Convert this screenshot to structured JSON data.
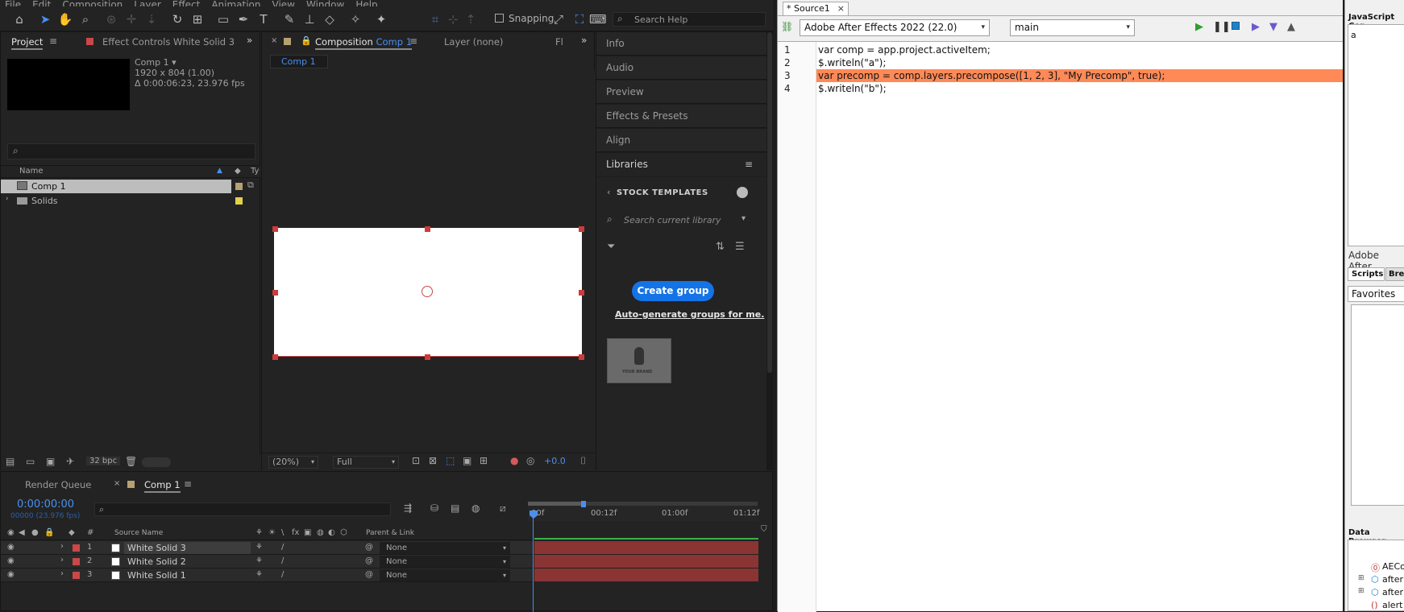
{
  "menu": [
    "File",
    "Edit",
    "Composition",
    "Layer",
    "Effect",
    "Animation",
    "View",
    "Window",
    "Help"
  ],
  "toolbar": {
    "snapping_label": "Snapping",
    "search_placeholder": "Search Help"
  },
  "project_panel": {
    "tab_project": "Project",
    "tab_effect_controls": "Effect Controls White Solid 3",
    "comp_name": "Comp 1 ▾",
    "comp_dims": "1920 x 804 (1.00)",
    "comp_duration": "Δ 0:00:06:23, 23.976 fps",
    "search_placeholder": "",
    "col_name": "Name",
    "col_type": "Ty",
    "items": [
      {
        "name": "Comp 1",
        "label_color": "#b7a071"
      },
      {
        "name": "Solids",
        "label_color": "#e3d04a"
      }
    ],
    "bpc": "32 bpc"
  },
  "composition_panel": {
    "tab_comp": "Composition",
    "tab_comp_name": "Comp 1",
    "tab_layer": "Layer (none)",
    "tab_more": "Fl",
    "breadcrumb": "Comp 1",
    "zoom": "(20%)",
    "resolution": "Full",
    "exposure": "+0.0"
  },
  "right_panels": {
    "items": [
      "Info",
      "Audio",
      "Preview",
      "Effects & Presets",
      "Align",
      "Libraries"
    ],
    "stock_templates": "STOCK TEMPLATES",
    "search_placeholder": "Search current library",
    "create_group": "Create group",
    "auto_generate": "Auto-generate groups for me.",
    "thumb_label": "YOUR BRAND"
  },
  "timeline": {
    "tab_render_queue": "Render Queue",
    "tab_comp": "Comp 1",
    "timecode": "0:00:00:00",
    "frames": "00000 (23.976 fps)",
    "col_source_name": "Source Name",
    "col_parent": "Parent & Link",
    "ruler": [
      "00f",
      "00:12f",
      "01:00f",
      "01:12f"
    ],
    "layers": [
      {
        "num": "1",
        "name": "White Solid 3",
        "parent": "None"
      },
      {
        "num": "2",
        "name": "White Solid 2",
        "parent": "None"
      },
      {
        "num": "3",
        "name": "White Solid 1",
        "parent": "None"
      }
    ]
  },
  "extendscript": {
    "tab": "* Source1",
    "target": "Adobe After Effects 2022 (22.0)",
    "engine": "main",
    "lines": [
      {
        "n": "1",
        "text": "var comp = app.project.activeItem;"
      },
      {
        "n": "2",
        "text": "$.writeln(\"a\");"
      },
      {
        "n": "3",
        "text": "var precomp = comp.layers.precompose([1, 2, 3], \"My Precomp\", true);"
      },
      {
        "n": "4",
        "text": "$.writeln(\"b\");"
      }
    ],
    "highlight_color": "#ff8a57"
  },
  "right_column": {
    "console_title": "JavaScript Cor",
    "console_output": "a",
    "after_label": "Adobe After",
    "tab_scripts": "Scripts",
    "tab_breakpoints": "Brea",
    "favorites": "Favorites",
    "data_browser": "Data Browser",
    "tree": [
      "AECo",
      "after",
      "after",
      "alert"
    ]
  }
}
